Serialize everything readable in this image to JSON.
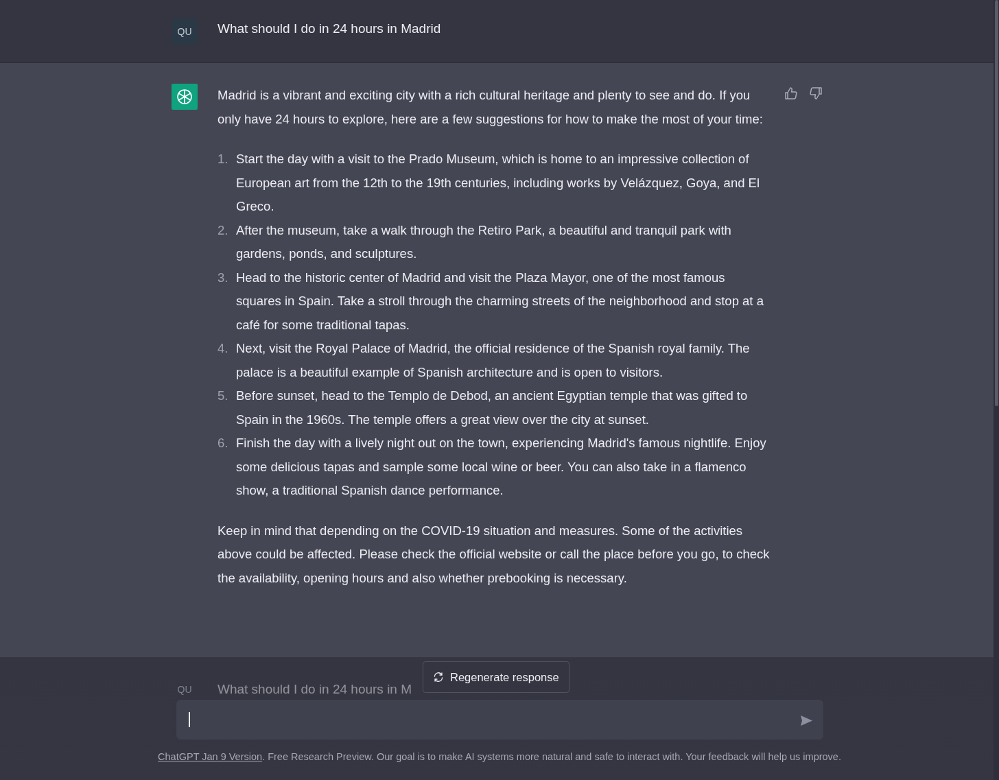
{
  "question": {
    "avatar": "QU",
    "text": "What should I do in 24 hours in Madrid"
  },
  "answer": {
    "intro": "Madrid is a vibrant and exciting city with a rich cultural heritage and plenty to see and do. If you only have 24 hours to explore, here are a few suggestions for how to make the most of your time:",
    "items": [
      {
        "number": "1.",
        "text": "Start the day with a visit to the Prado Museum, which is home to an impressive collection of European art from the 12th to the 19th centuries, including works by Velázquez, Goya, and El Greco."
      },
      {
        "number": "2.",
        "text": "After the museum, take a walk through the Retiro Park, a beautiful and tranquil park with gardens, ponds, and sculptures."
      },
      {
        "number": "3.",
        "text": "Head to the historic center of Madrid and visit the Plaza Mayor, one of the most famous squares in Spain. Take a stroll through the charming streets of the neighborhood and stop at a café for some traditional tapas."
      },
      {
        "number": "4.",
        "text": "Next, visit the Royal Palace of Madrid, the official residence of the Spanish royal family. The palace is a beautiful example of Spanish architecture and is open to visitors."
      },
      {
        "number": "5.",
        "text": "Before sunset, head to the Templo de Debod, an ancient Egyptian temple that was gifted to Spain in the 1960s. The temple offers a great view over the city at sunset."
      },
      {
        "number": "6.",
        "text": "Finish the day with a lively night out on the town, experiencing Madrid's famous nightlife. Enjoy some delicious tapas and sample some local wine or beer. You can also take in a flamenco show, a traditional Spanish dance performance."
      }
    ],
    "outro": "Keep in mind that depending on the COVID-19 situation and measures. Some of the activities above could be affected. Please check the official website or call the place before you go, to check the availability, opening hours and also whether prebooking is necessary."
  },
  "faded_question": {
    "avatar": "QU",
    "text": "What should I do in 24 hours in M"
  },
  "regenerate_button": "Regenerate response",
  "footer": {
    "link": "ChatGPT Jan 9 Version",
    "text": ". Free Research Preview. Our goal is to make AI systems more natural and safe to interact with. Your feedback will help us improve."
  }
}
